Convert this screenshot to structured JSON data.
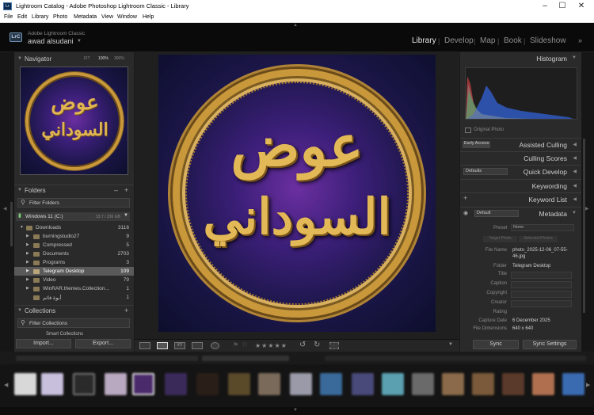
{
  "window": {
    "title": "Lightroom Catalog - Adobe Photoshop Lightroom Classic - Library"
  },
  "menu": [
    "File",
    "Edit",
    "Library",
    "Photo",
    "Metadata",
    "View",
    "Window",
    "Help"
  ],
  "identity": {
    "badge": "LrC",
    "product": "Adobe Lightroom Classic",
    "user": "awad alsudani"
  },
  "modules": [
    "Library",
    "Develop",
    "Map",
    "Book",
    "Slideshow"
  ],
  "navigator": {
    "title": "Navigator",
    "zoom": [
      "FIT",
      "100%",
      "300%"
    ],
    "arabic_top": "عوض",
    "arabic_bottom": "السوداني"
  },
  "folders": {
    "title": "Folders",
    "filter": "Filter Folders",
    "volume": {
      "name": "Windows 11 (C:)",
      "size": "33.7 / 236 GB"
    },
    "items": [
      {
        "name": "Downloads",
        "count": "3116"
      },
      {
        "name": "burningstudio27",
        "count": "9"
      },
      {
        "name": "Compressed",
        "count": "5"
      },
      {
        "name": "Documents",
        "count": "2703"
      },
      {
        "name": "Programs",
        "count": "3"
      },
      {
        "name": "Telegram Desktop",
        "count": "109"
      },
      {
        "name": "Video",
        "count": "79"
      },
      {
        "name": "WinRAR.themes.Collection...",
        "count": "1"
      },
      {
        "name": "أبوة فائم",
        "count": "1"
      }
    ]
  },
  "collections": {
    "title": "Collections",
    "filter": "Filter Collections",
    "smart": "Smart Collections"
  },
  "left_buttons": {
    "import": "Import...",
    "export": "Export..."
  },
  "right": {
    "histogram": "Histogram",
    "original_photo": "Original Photo",
    "assisted_culling": "Assisted Culling",
    "early_access": "Early Access",
    "culling_scores": "Culling Scores",
    "quick_develop": "Quick Develop",
    "defaults": "Defaults",
    "keywording": "Keywording",
    "keyword_list": "Keyword List",
    "metadata": "Metadata",
    "default": "Default",
    "preset_label": "Preset",
    "preset_value": "None",
    "target_photo": "Target Photo",
    "selected_photos": "Selected Photos",
    "fields": [
      {
        "label": "File Name",
        "value": "photo_2025-12-06_07-55-46.jpg"
      },
      {
        "label": "Folder",
        "value": "Telegram Desktop"
      },
      {
        "label": "Title",
        "value": ""
      },
      {
        "label": "Caption",
        "value": ""
      },
      {
        "label": "Copyright",
        "value": ""
      },
      {
        "label": "Creator",
        "value": ""
      },
      {
        "label": "Rating",
        "value": ""
      },
      {
        "label": "Capture Date",
        "value": "6 December 2025"
      },
      {
        "label": "File Dimensions",
        "value": "640 x 640"
      }
    ],
    "sync": "Sync",
    "sync_settings": "Sync Settings"
  },
  "photo": {
    "arabic_top": "عوض",
    "arabic_bottom": "السوداني"
  },
  "rating_stars": "★★★★★",
  "colors": {
    "panel": "#2a2a2a",
    "background": "#1b1b1b",
    "accent_gold": "#d4a640",
    "selection": "#5a5a5a"
  }
}
